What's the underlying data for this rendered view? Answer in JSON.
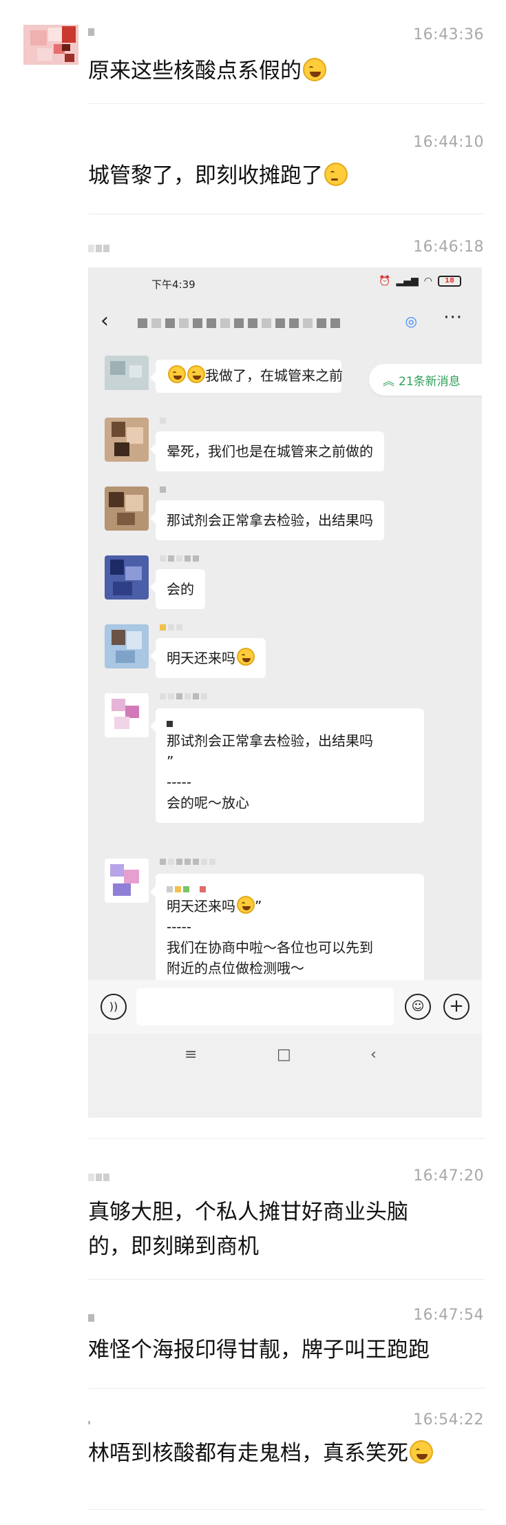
{
  "messages": [
    {
      "time": "16:43:36",
      "text": "原来这些核酸点系假的",
      "emoji": "rofl-emoji"
    },
    {
      "time": "16:44:10",
      "text": "城管黎了，即刻收摊跑了",
      "emoji": "thinking-emoji"
    },
    {
      "time": "16:46:18"
    },
    {
      "time": "16:47:20",
      "line1": "真够大胆，个私人摊甘好商业头脑",
      "line2": "的，即刻睇到商机"
    },
    {
      "time": "16:47:54",
      "text": "难怪个海报印得甘靓，牌子叫王跑跑"
    },
    {
      "time": "16:54:22",
      "text": "林唔到核酸都有走鬼档，真系笑死",
      "emoji": "rofl-emoji"
    }
  ],
  "screenshot": {
    "status_time": "下午4:39",
    "battery": "18",
    "new_messages": "21条新消息",
    "bubbles": [
      {
        "text": "我做了，在城管来之前"
      },
      {
        "text": "晕死，我们也是在城管来之前做的"
      },
      {
        "text": "那试剂会正常拿去检验，出结果吗"
      },
      {
        "text": "会的"
      },
      {
        "text": "明天还来吗"
      },
      {
        "quote": "那试剂会正常拿去检验，出结果吗",
        "quote_close": "”",
        "divider": "-----",
        "reply": "会的呢～放心"
      },
      {
        "quote": "明天还来吗",
        "quote_close": "”",
        "divider": "-----",
        "reply1": "我们在协商中啦～各位也可以先到",
        "reply2": "附近的点位做检测哦～"
      }
    ]
  }
}
